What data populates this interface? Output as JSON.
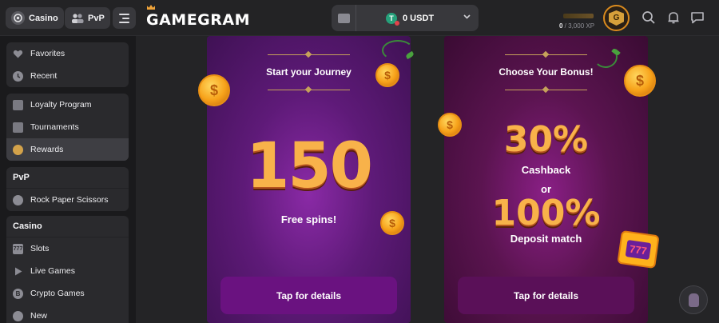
{
  "topbar": {
    "casino_label": "Casino",
    "pvp_label": "PvP",
    "logo": "GAMEGRAM",
    "wallet": {
      "balance": "0 USDT",
      "currency_icon": "usdt-icon"
    },
    "xp": {
      "current": "0",
      "total": " / 3,000 XP"
    },
    "avatar_letter": "G"
  },
  "sidebar": {
    "group1": [
      {
        "label": "Favorites",
        "icon": "heart-icon"
      },
      {
        "label": "Recent",
        "icon": "clock-icon"
      }
    ],
    "group2": [
      {
        "label": "Loyalty Program",
        "icon": "crown-icon"
      },
      {
        "label": "Tournaments",
        "icon": "trophy-icon"
      },
      {
        "label": "Rewards",
        "icon": "rewards-icon",
        "active": true
      }
    ],
    "pvp": {
      "title": "PvP",
      "items": [
        {
          "label": "Rock Paper Scissors",
          "icon": "rps-icon"
        }
      ]
    },
    "casino": {
      "title": "Casino",
      "items": [
        {
          "label": "Slots",
          "icon": "slots-icon"
        },
        {
          "label": "Live Games",
          "icon": "play-icon"
        },
        {
          "label": "Crypto Games",
          "icon": "bitcoin-icon"
        },
        {
          "label": "New",
          "icon": "new-icon"
        }
      ]
    }
  },
  "cards": [
    {
      "title": "Start your Journey",
      "big": "150",
      "subtitle": "Free spins!",
      "button": "Tap for details"
    },
    {
      "title": "Choose Your Bonus!",
      "big1": "30%",
      "sub1": "Cashback",
      "or": "or",
      "big2": "100%",
      "sub2": "Deposit match",
      "button": "Tap for details"
    }
  ],
  "colors": {
    "accent": "#d98a1e",
    "card1": "#5e1a78",
    "card2": "#5b1450",
    "button1": "#6a1280",
    "button2": "#5a1058"
  }
}
